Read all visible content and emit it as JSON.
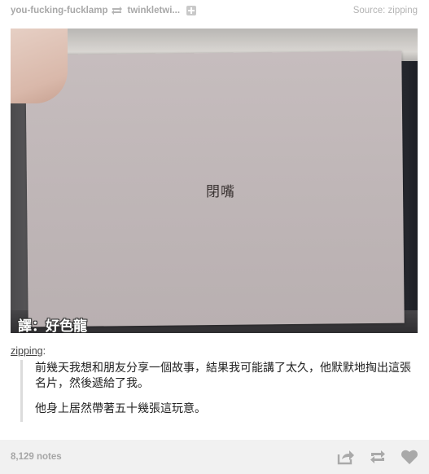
{
  "header": {
    "blog_name": "you-fucking-fucklamp",
    "reblog_icon": "reblog-arrows-icon",
    "reblogged_from": "twinkletwi...",
    "follow_icon": "plus-icon",
    "source_label": "Source: zipping"
  },
  "photo": {
    "card_text": "閉嘴",
    "watermark": "譯：好色龍"
  },
  "caption": {
    "author": "zipping",
    "author_suffix": ":",
    "paragraphs": [
      "前幾天我想和朋友分享一個故事，結果我可能講了太久，他默默地掏出這張名片，然後遞給了我。",
      "他身上居然帶著五十幾張這玩意。"
    ]
  },
  "footer": {
    "notes": "8,129 notes",
    "share_icon": "share-icon",
    "reblog_icon": "reblog-icon",
    "like_icon": "heart-icon"
  },
  "colors": {
    "muted_text": "#a8a8a8",
    "footer_bg": "#f1f1f1",
    "quote_border": "#dcdcdc"
  }
}
